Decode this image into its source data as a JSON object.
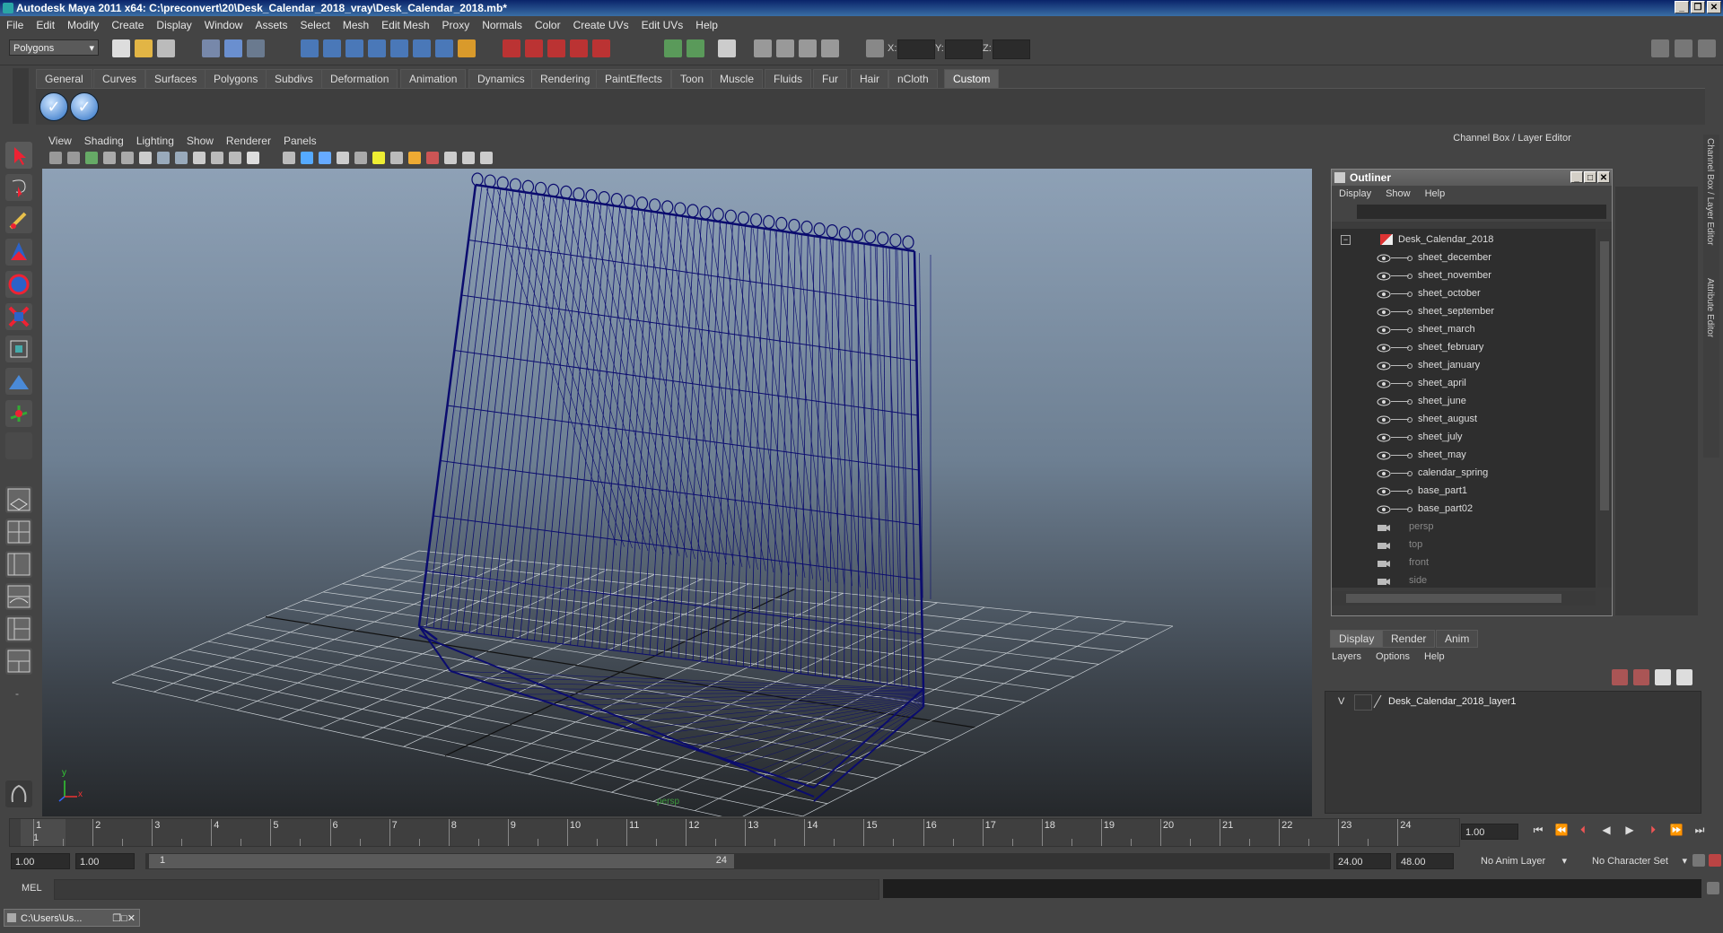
{
  "window": {
    "title": "Autodesk Maya 2011 x64: C:\\preconvert\\20\\Desk_Calendar_2018_vray\\Desk_Calendar_2018.mb*"
  },
  "menubar": [
    "File",
    "Edit",
    "Modify",
    "Create",
    "Display",
    "Window",
    "Assets",
    "Select",
    "Mesh",
    "Edit Mesh",
    "Proxy",
    "Normals",
    "Color",
    "Create UVs",
    "Edit UVs",
    "Help"
  ],
  "statusline": {
    "mode_select": "Polygons",
    "x_label": "X:",
    "y_label": "Y:",
    "z_label": "Z:"
  },
  "shelf_tabs": [
    "General",
    "Curves",
    "Surfaces",
    "Polygons",
    "Subdivs",
    "Deformation",
    "Animation",
    "Dynamics",
    "Rendering",
    "PaintEffects",
    "Toon",
    "Muscle",
    "Fluids",
    "Fur",
    "Hair",
    "nCloth",
    "Custom"
  ],
  "shelf_active": "Custom",
  "viewport": {
    "menu": [
      "View",
      "Shading",
      "Lighting",
      "Show",
      "Renderer",
      "Panels"
    ],
    "camera_label": "persp",
    "axis_x": "x",
    "axis_y": "y"
  },
  "channelbox": {
    "header": "Channel Box / Layer Editor",
    "side_tab1": "Channel Box / Layer Editor",
    "side_tab2": "Attribute Editor"
  },
  "outliner": {
    "title": "Outliner",
    "menu": [
      "Display",
      "Show",
      "Help"
    ],
    "root": "Desk_Calendar_2018",
    "children": [
      "sheet_december",
      "sheet_november",
      "sheet_october",
      "sheet_september",
      "sheet_march",
      "sheet_february",
      "sheet_january",
      "sheet_april",
      "sheet_june",
      "sheet_august",
      "sheet_july",
      "sheet_may",
      "calendar_spring",
      "base_part1",
      "base_part02"
    ],
    "cameras": [
      "persp",
      "top",
      "front",
      "side"
    ]
  },
  "layer_editor": {
    "tabs": [
      "Display",
      "Render",
      "Anim"
    ],
    "menu": [
      "Layers",
      "Options",
      "Help"
    ],
    "layer_visible": "V",
    "layer_name": "Desk_Calendar_2018_layer1"
  },
  "timeline": {
    "ticks": [
      "1",
      "2",
      "3",
      "4",
      "5",
      "6",
      "7",
      "8",
      "9",
      "10",
      "11",
      "12",
      "13",
      "14",
      "15",
      "16",
      "17",
      "18",
      "19",
      "20",
      "21",
      "22",
      "23",
      "24"
    ],
    "current_frame": "1.00",
    "current_marker": "1"
  },
  "range": {
    "start": "1.00",
    "start2": "1.00",
    "slider_start": "1",
    "slider_end": "24",
    "end": "24.00",
    "end2": "48.00",
    "anim_layer": "No Anim Layer",
    "char_set": "No Character Set"
  },
  "mel": {
    "label": "MEL"
  },
  "taskbar": {
    "item": "C:\\Users\\Us..."
  }
}
